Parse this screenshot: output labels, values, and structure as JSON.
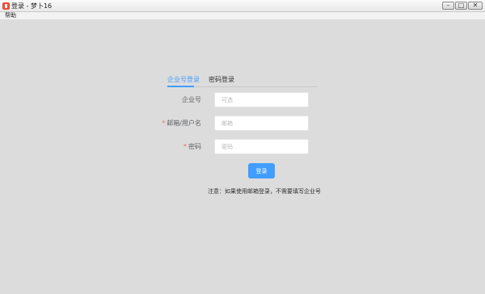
{
  "window": {
    "title": "登录 - 梦卜16",
    "icon": "app-icon",
    "buttons": {
      "minimize": "–",
      "maximize": "□",
      "close": "✕"
    }
  },
  "menubar": {
    "items": [
      {
        "label": "帮助"
      }
    ]
  },
  "login": {
    "tabs": [
      {
        "label": "企业号登录",
        "active": true
      },
      {
        "label": "密码登录",
        "active": false
      }
    ],
    "fields": {
      "company": {
        "label": "企业号",
        "required": false,
        "placeholder": "可选",
        "value": ""
      },
      "username": {
        "label": "邮箱/用户名",
        "required": true,
        "required_mark": "*",
        "placeholder": "邮箱",
        "value": ""
      },
      "password": {
        "label": "密码",
        "required": true,
        "required_mark": "*",
        "placeholder": "密码",
        "value": ""
      }
    },
    "submit_label": "登录",
    "note": "注意：如果使用邮箱登录，不需要填写企业号"
  },
  "colors": {
    "accent": "#409eff",
    "required": "#f56c6c",
    "background": "#dcdcdc",
    "app_icon": "#e8503a"
  }
}
